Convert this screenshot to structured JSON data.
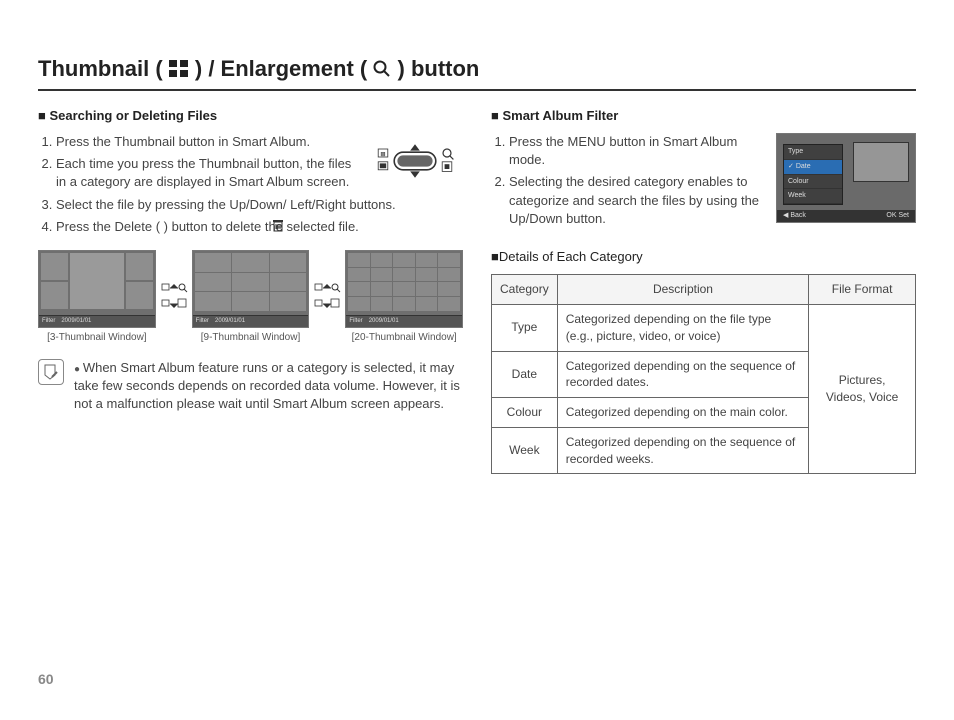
{
  "title": {
    "prefix": "Thumbnail ( ",
    "mid": " ) / Enlargement ( ",
    "suffix": " ) button"
  },
  "left": {
    "heading": "Searching or Deleting Files",
    "steps": [
      "Press the Thumbnail button in Smart Album.",
      "Each time you press the Thumbnail button, the files in a category are displayed in Smart Album screen.",
      "Select the file by pressing the Up/Down/ Left/Right buttons.",
      "Press the Delete (      ) button to delete the selected file."
    ],
    "thumbs": {
      "filter_label": "Filter",
      "date_label": "2009/01/01",
      "captions": [
        "[3-Thumbnail Window]",
        "[9-Thumbnail Window]",
        "[20-Thumbnail Window]"
      ]
    },
    "note": "When Smart Album feature runs or a category is selected, it may take few seconds depends on recorded data volume. However, it is not a malfunction please wait until Smart Album screen appears."
  },
  "right": {
    "heading": "Smart Album Filter",
    "steps": [
      "Press the MENU button in Smart Album mode.",
      "Selecting the desired category enables to categorize and search the files by using the Up/Down button."
    ],
    "menu_items": [
      "Type",
      "Date",
      "Colour",
      "Week"
    ],
    "menu_back": "Back",
    "menu_set": "Set",
    "sub_heading": "Details of Each Category",
    "table": {
      "headers": [
        "Category",
        "Description",
        "File Format"
      ],
      "rows": [
        {
          "cat": "Type",
          "desc": "Categorized depending on the file type (e.g., picture, video, or voice)"
        },
        {
          "cat": "Date",
          "desc": "Categorized depending on the sequence of recorded dates."
        },
        {
          "cat": "Colour",
          "desc": "Categorized depending on the main color."
        },
        {
          "cat": "Week",
          "desc": "Categorized depending on the sequence of recorded weeks."
        }
      ],
      "file_format": "Pictures, Videos, Voice"
    }
  },
  "page_number": "60"
}
